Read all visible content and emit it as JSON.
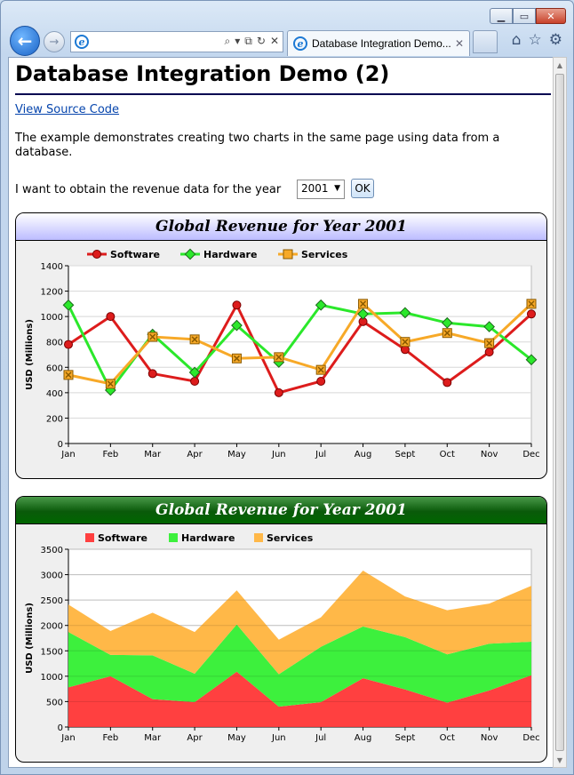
{
  "browser": {
    "tab_title": "Database Integration Demo...",
    "tab_close": "✕"
  },
  "page": {
    "title": "Database Integration Demo (2)",
    "source_link": "View Source Code",
    "description": "The example demonstrates creating two charts in the same page using data from a database.",
    "prompt": "I want to obtain the revenue data for the year",
    "year_select": "2001",
    "ok_button": "OK"
  },
  "chart_data": [
    {
      "type": "line",
      "title": "Global Revenue for Year 2001",
      "ylabel": "USD (Millions)",
      "xlabel": "",
      "ylim": [
        0,
        1400
      ],
      "yticks": [
        0,
        200,
        400,
        600,
        800,
        1000,
        1200,
        1400
      ],
      "categories": [
        "Jan",
        "Feb",
        "Mar",
        "Apr",
        "May",
        "Jun",
        "Jul",
        "Aug",
        "Sept",
        "Oct",
        "Nov",
        "Dec"
      ],
      "legend": "top",
      "grid": true,
      "series": [
        {
          "name": "Software",
          "color": "#dd1c1c",
          "values": [
            780,
            1000,
            550,
            490,
            1090,
            400,
            490,
            960,
            740,
            480,
            720,
            1020
          ]
        },
        {
          "name": "Hardware",
          "color": "#2be82b",
          "values": [
            1090,
            420,
            860,
            560,
            930,
            640,
            1090,
            1020,
            1030,
            950,
            920,
            660
          ]
        },
        {
          "name": "Services",
          "color": "#f7a928",
          "values": [
            540,
            470,
            840,
            820,
            670,
            680,
            580,
            1100,
            800,
            870,
            790,
            1100
          ]
        }
      ]
    },
    {
      "type": "area",
      "stacked": true,
      "title": "Global Revenue for Year 2001",
      "ylabel": "USD (Millions)",
      "xlabel": "",
      "ylim": [
        0,
        3500
      ],
      "yticks": [
        0,
        500,
        1000,
        1500,
        2000,
        2500,
        3000,
        3500
      ],
      "categories": [
        "Jan",
        "Feb",
        "Mar",
        "Apr",
        "May",
        "Jun",
        "Jul",
        "Aug",
        "Sept",
        "Oct",
        "Nov",
        "Dec"
      ],
      "legend": "top",
      "grid": true,
      "series": [
        {
          "name": "Software",
          "color": "#ff4040",
          "values": [
            780,
            1000,
            550,
            490,
            1090,
            400,
            490,
            960,
            740,
            480,
            720,
            1020
          ]
        },
        {
          "name": "Hardware",
          "color": "#3df03d",
          "values": [
            1090,
            420,
            860,
            560,
            930,
            640,
            1090,
            1020,
            1030,
            950,
            920,
            660
          ]
        },
        {
          "name": "Services",
          "color": "#ffb848",
          "values": [
            540,
            470,
            840,
            820,
            670,
            680,
            580,
            1100,
            800,
            870,
            790,
            1100
          ]
        }
      ]
    }
  ]
}
